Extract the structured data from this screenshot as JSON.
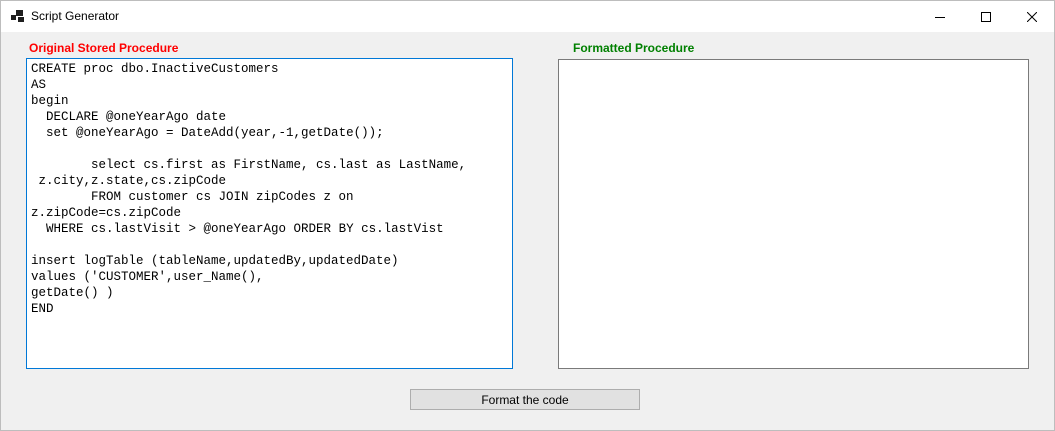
{
  "window": {
    "title": "Script Generator",
    "app_icon": "app-window-icon",
    "controls": {
      "minimize_icon": "minimize-icon",
      "maximize_icon": "maximize-icon",
      "close_icon": "close-icon"
    }
  },
  "original": {
    "label": "Original Stored Procedure",
    "label_color": "#ff0000",
    "code": "CREATE proc dbo.InactiveCustomers\nAS\nbegin\n  DECLARE @oneYearAgo date\n  set @oneYearAgo = DateAdd(year,-1,getDate());\n\n        select cs.first as FirstName, cs.last as LastName,\n z.city,z.state,cs.zipCode\n        FROM customer cs JOIN zipCodes z on\nz.zipCode=cs.zipCode\n  WHERE cs.lastVisit > @oneYearAgo ORDER BY cs.lastVist\n\ninsert logTable (tableName,updatedBy,updatedDate)\nvalues ('CUSTOMER',user_Name(),\ngetDate() )\nEND\n"
  },
  "formatted": {
    "label": "Formatted Procedure",
    "label_color": "#008000",
    "code": ""
  },
  "actions": {
    "format_label": "Format the code"
  }
}
